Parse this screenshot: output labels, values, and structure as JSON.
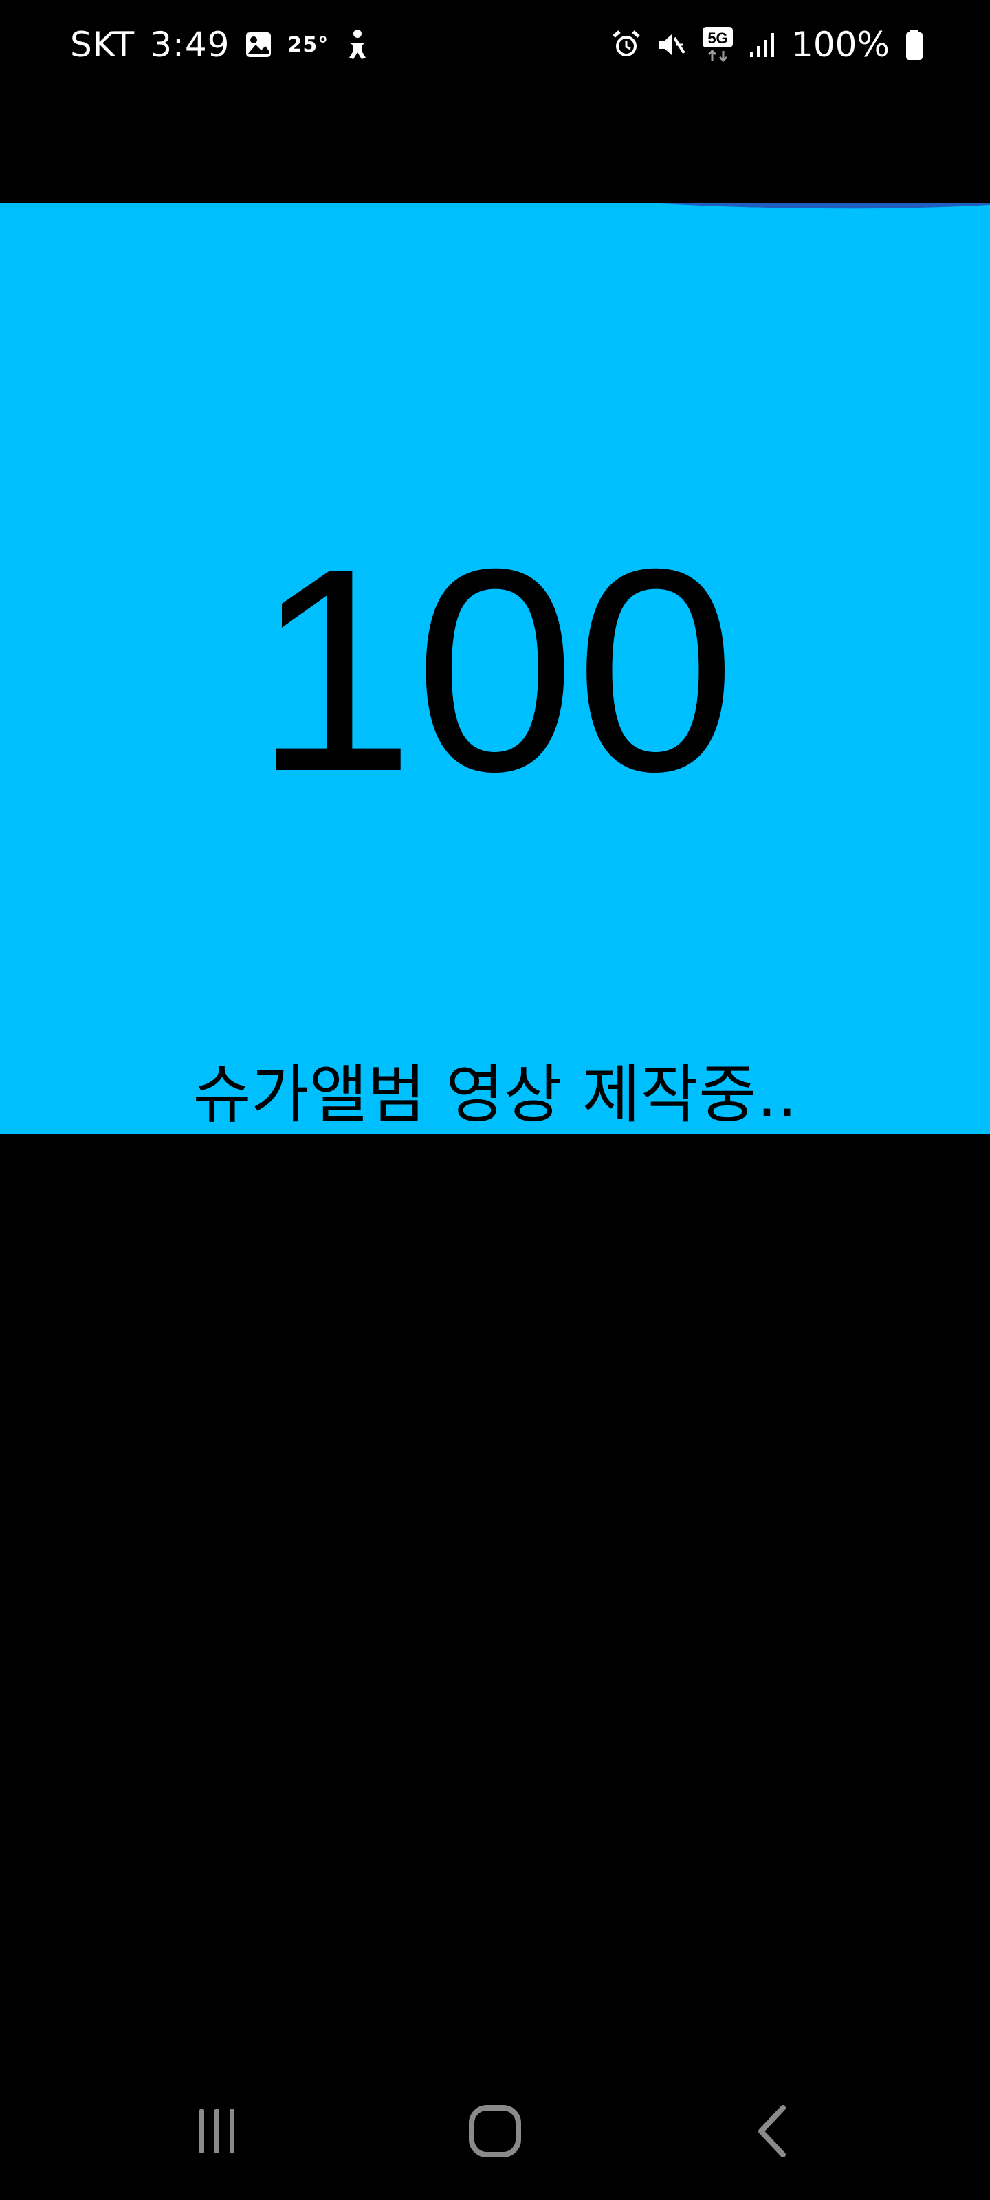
{
  "status_bar": {
    "carrier": "SKT",
    "time": "3:49",
    "temperature": "25°",
    "network": "5G",
    "battery": "100%",
    "left_icons": [
      "gallery-icon",
      "temperature-badge",
      "accessibility-icon"
    ],
    "right_icons": [
      "alarm-icon",
      "mute-icon",
      "5g-icon",
      "signal-icon",
      "battery-icon"
    ]
  },
  "progress": {
    "percent": 100,
    "value_text": "100",
    "message": "슈가앨범 영상 제작중.."
  },
  "nav_bar": {
    "icons": [
      "recent-apps-icon",
      "home-icon",
      "back-icon"
    ]
  },
  "colors": {
    "panel": "#00bfff",
    "background": "#000000",
    "text": "#000000",
    "status_text": "#ffffff",
    "nav_icon": "#8a8a8a",
    "progress_accent": "#1f5fbf"
  }
}
